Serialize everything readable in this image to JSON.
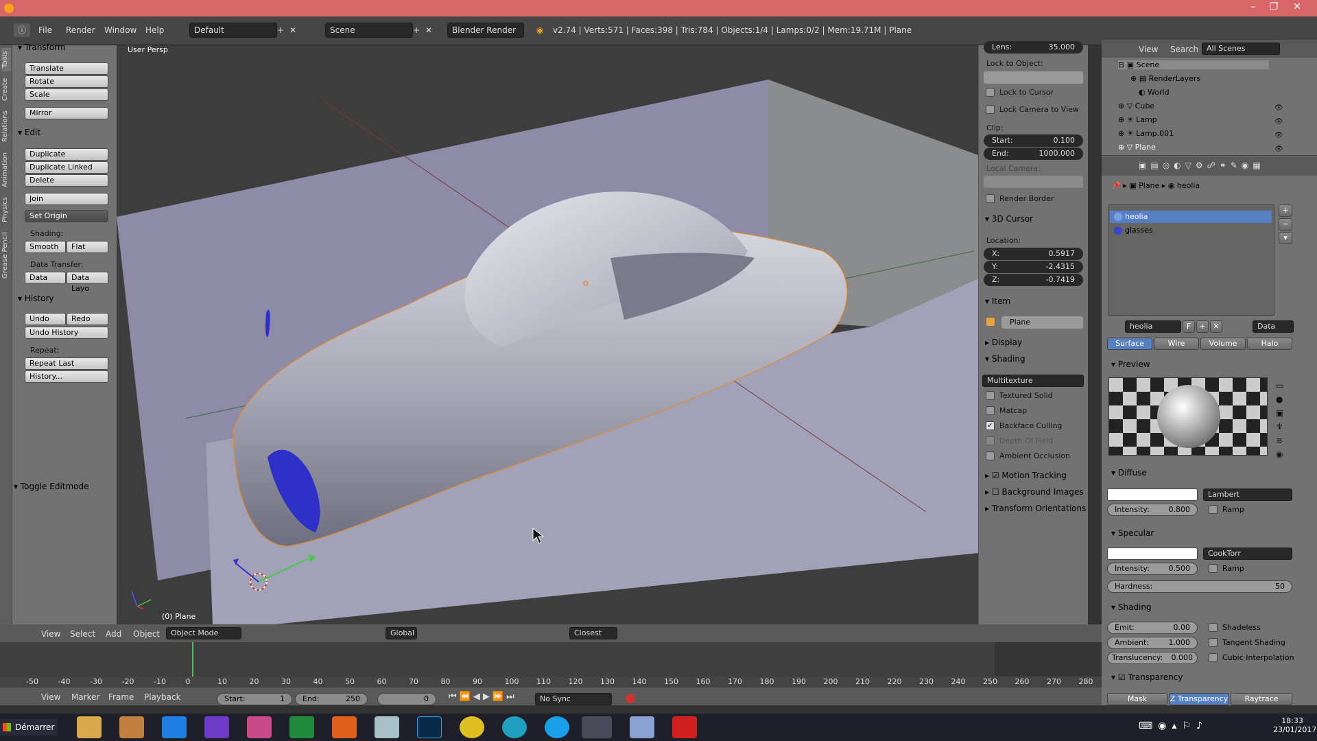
{
  "infobar": {
    "menus": [
      "File",
      "Render",
      "Window",
      "Help"
    ],
    "layout": "Default",
    "scene": "Scene",
    "engine": "Blender Render",
    "stats": "v2.74 | Verts:571 | Faces:398 | Tris:784 | Objects:1/4 | Lamps:0/2 | Mem:19.71M | Plane"
  },
  "tabs": [
    "Tools",
    "Create",
    "Relations",
    "Animation",
    "Physics",
    "Grease Pencil"
  ],
  "toolshelf": {
    "transform_title": "Transform",
    "translate": "Translate",
    "rotate": "Rotate",
    "scale": "Scale",
    "mirror": "Mirror",
    "edit_title": "Edit",
    "duplicate": "Duplicate",
    "duplicate_linked": "Duplicate Linked",
    "delete": "Delete",
    "join": "Join",
    "set_origin": "Set Origin",
    "shading_label": "Shading:",
    "smooth": "Smooth",
    "flat": "Flat",
    "data_transfer_label": "Data Transfer:",
    "data": "Data",
    "data_layo": "Data Layo",
    "history_title": "History",
    "undo": "Undo",
    "redo": "Redo",
    "undo_history": "Undo History",
    "repeat_label": "Repeat:",
    "repeat_last": "Repeat Last",
    "history": "History...",
    "toggle_editmode": "Toggle Editmode"
  },
  "viewport": {
    "view_name": "User Persp",
    "object_label": "(0) Plane"
  },
  "npanel": {
    "lens_label": "Lens:",
    "lens_value": "35.000",
    "lock_to_object": "Lock to Object:",
    "lock_to_cursor": "Lock to Cursor",
    "lock_camera": "Lock Camera to View",
    "clip": "Clip:",
    "start_label": "Start:",
    "start_value": "0.100",
    "end_label": "End:",
    "end_value": "1000.000",
    "local_camera": "Local Camera:",
    "render_border": "Render Border",
    "cursor_title": "3D Cursor",
    "location": "Location:",
    "x_label": "X:",
    "x_value": "0.5917",
    "y_label": "Y:",
    "y_value": "-2.4315",
    "z_label": "Z:",
    "z_value": "-0.7419",
    "item_title": "Item",
    "item_name": "Plane",
    "display_title": "Display",
    "shading_title": "Shading",
    "shading_mode": "Multitexture",
    "textured_solid": "Textured Solid",
    "matcap": "Matcap",
    "backface_culling": "Backface Culling",
    "depth_of_field": "Depth Of Field",
    "ambient_occlusion": "Ambient Occlusion",
    "motion_tracking": "Motion Tracking",
    "background_images": "Background Images",
    "transform_orientations": "Transform Orientations"
  },
  "outliner": {
    "view": "View",
    "search": "Search",
    "filter": "All Scenes",
    "items": [
      "Scene",
      "RenderLayers",
      "World",
      "Cube",
      "Lamp",
      "Lamp.001",
      "Plane"
    ]
  },
  "props": {
    "breadcrumb_object": "Plane",
    "breadcrumb_material": "heolia",
    "materials": [
      "heolia",
      "glasses"
    ],
    "material_name": "heolia",
    "f_label": "F",
    "data_label": "Data",
    "tabs": [
      "Surface",
      "Wire",
      "Volume",
      "Halo"
    ],
    "preview_title": "Preview",
    "diffuse_title": "Diffuse",
    "diffuse_shader": "Lambert",
    "intensity_label": "Intensity:",
    "diffuse_intensity": "0.800",
    "ramp": "Ramp",
    "specular_title": "Specular",
    "specular_shader": "CookTorr",
    "specular_intensity": "0.500",
    "hardness_label": "Hardness:",
    "hardness_value": "50",
    "shading_title": "Shading",
    "emit_label": "Emit:",
    "emit_value": "0.00",
    "ambient_label": "Ambient:",
    "ambient_value": "1.000",
    "translucency_label": "Translucency:",
    "translucency_value": "0.000",
    "shadeless": "Shadeless",
    "tangent_shading": "Tangent Shading",
    "cubic_interpolation": "Cubic Interpolation",
    "transparency_title": "Transparency",
    "trans_tabs": [
      "Mask",
      "Z Transparency",
      "Raytrace"
    ]
  },
  "viewheader": {
    "view": "View",
    "select": "Select",
    "add": "Add",
    "object": "Object",
    "mode": "Object Mode",
    "orientation": "Global",
    "snap": "Closest"
  },
  "timeline": {
    "ticks": [
      "-50",
      "-40",
      "-30",
      "-20",
      "-10",
      "0",
      "10",
      "20",
      "30",
      "40",
      "50",
      "60",
      "70",
      "80",
      "90",
      "100",
      "110",
      "120",
      "130",
      "140",
      "150",
      "160",
      "170",
      "180",
      "190",
      "200",
      "210",
      "220",
      "230",
      "240",
      "250",
      "260",
      "270",
      "280"
    ],
    "view": "View",
    "marker": "Marker",
    "frame": "Frame",
    "playback": "Playback",
    "start_label": "Start:",
    "start_value": "1",
    "end_label": "End:",
    "end_value": "250",
    "current": "0",
    "sync": "No Sync"
  },
  "taskbar": {
    "start": "Démarrer",
    "time": "18:33",
    "date": "23/01/2017"
  }
}
